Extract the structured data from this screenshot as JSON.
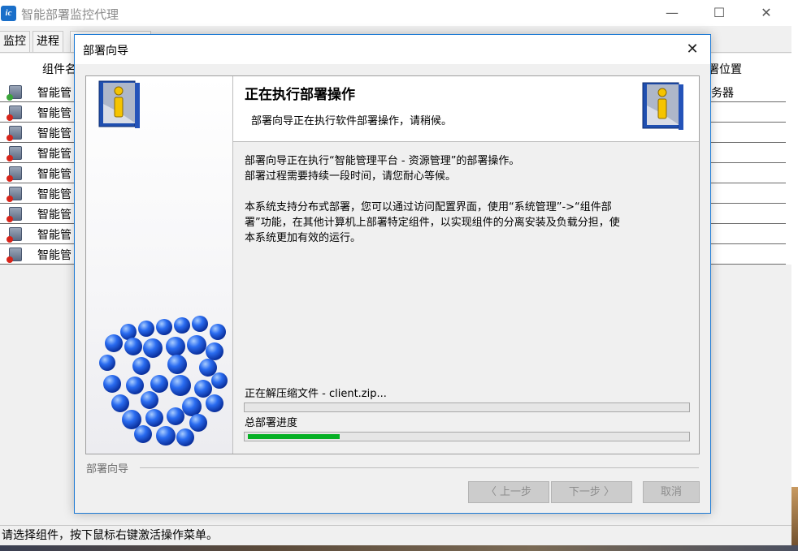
{
  "app": {
    "title": "智能部署监控代理",
    "icon_text": "ic"
  },
  "window_controls": {
    "minimize": "—",
    "maximize": "☐",
    "close": "✕"
  },
  "tabs": [
    {
      "label": "监控"
    },
    {
      "label": "进程"
    }
  ],
  "table": {
    "headers": {
      "name": "组件名",
      "location": "署位置"
    },
    "rows": [
      {
        "name": "智能管",
        "location": "服务器",
        "status": "ok"
      },
      {
        "name": "智能管",
        "location": "",
        "status": "error"
      },
      {
        "name": "智能管",
        "location": "",
        "status": "error"
      },
      {
        "name": "智能管",
        "location": "",
        "status": "error"
      },
      {
        "name": "智能管",
        "location": "",
        "status": "error"
      },
      {
        "name": "智能管",
        "location": "",
        "status": "error"
      },
      {
        "name": "智能管",
        "location": "",
        "status": "error"
      },
      {
        "name": "智能管",
        "location": "",
        "status": "error"
      },
      {
        "name": "智能管",
        "location": "",
        "status": "error"
      }
    ]
  },
  "status_bar": {
    "text": "请选择组件，按下鼠标右键激活操作菜单。"
  },
  "wizard": {
    "title": "部署向导",
    "close": "✕",
    "header_title": "正在执行部署操作",
    "header_subtitle": "部署向导正在执行软件部署操作，请稍候。",
    "paragraph1_line1": "部署向导正在执行“智能管理平台 - 资源管理”的部署操作。",
    "paragraph1_line2": "部署过程需要持续一段时间，请您耐心等候。",
    "paragraph2_line1": "本系统支持分布式部署，您可以通过访问配置界面，使用“系统管理”->“组件部",
    "paragraph2_line2": "署”功能，在其他计算机上部署特定组件，以实现组件的分离安装及负载分担，使",
    "paragraph2_line3": "本系统更加有效的运行。",
    "file_progress_label": "正在解压缩文件 - client.zip...",
    "file_progress": 0.0,
    "total_progress_label": "总部署进度",
    "total_progress": 0.21,
    "footer_legend": "部署向导",
    "buttons": {
      "back": "〈 上一步",
      "next": "下一步 〉",
      "cancel": "取消"
    }
  },
  "colors": {
    "accent": "#1d7ad4",
    "progress": "#06b025"
  }
}
